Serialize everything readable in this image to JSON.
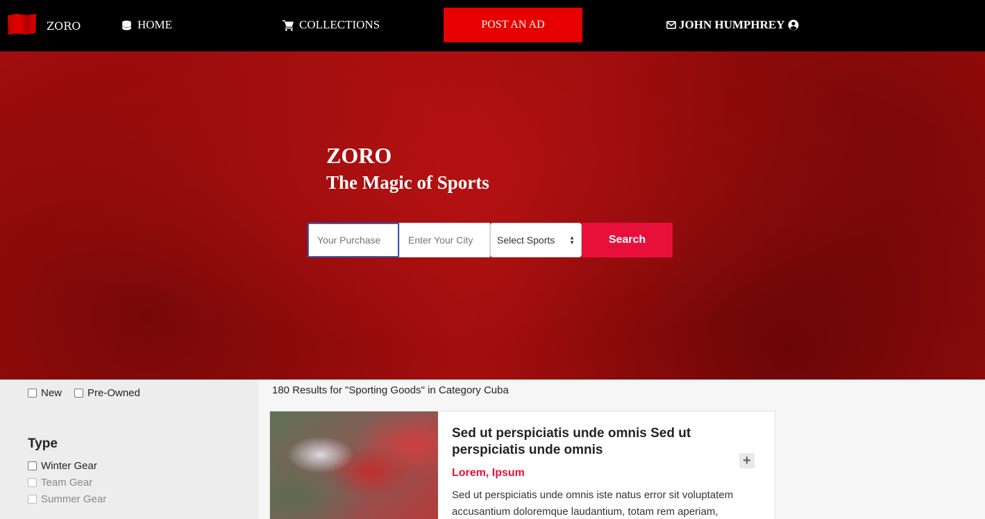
{
  "nav": {
    "brand": "ZORO",
    "home": "HOME",
    "collections": "COLLECTIONS",
    "post_ad": "POST AN AD",
    "user": "JOHN HUMPHREY"
  },
  "hero": {
    "title": "ZORO",
    "subtitle": "The Magic of Sports"
  },
  "search": {
    "purchase_placeholder": "Your Purchase",
    "city_placeholder": "Enter Your City",
    "sports_selected": "Select Sports",
    "button": "Search"
  },
  "filters": {
    "condition": [
      {
        "label": "New",
        "checked": false
      },
      {
        "label": "Pre-Owned",
        "checked": false
      }
    ],
    "type_heading": "Type",
    "types": [
      {
        "label": "Winter Gear",
        "checked": false
      },
      {
        "label": "Team Gear",
        "checked": false
      },
      {
        "label": "Summer Gear",
        "checked": false
      }
    ]
  },
  "results": {
    "summary": "180 Results for \"Sporting Goods\" in Category Cuba",
    "items": [
      {
        "title": "Sed ut perspiciatis unde omnis Sed ut perspiciatis unde omnis",
        "subtitle": "Lorem, Ipsum",
        "description": "Sed ut perspiciatis unde omnis iste natus error sit voluptatem accusantium doloremque laudantium, totam rem aperiam,",
        "expand": "+"
      }
    ]
  },
  "colors": {
    "nav_bg": "#000000",
    "accent_red": "#e60000",
    "search_red": "#e8103a",
    "hero_red": "#a80e0e"
  }
}
